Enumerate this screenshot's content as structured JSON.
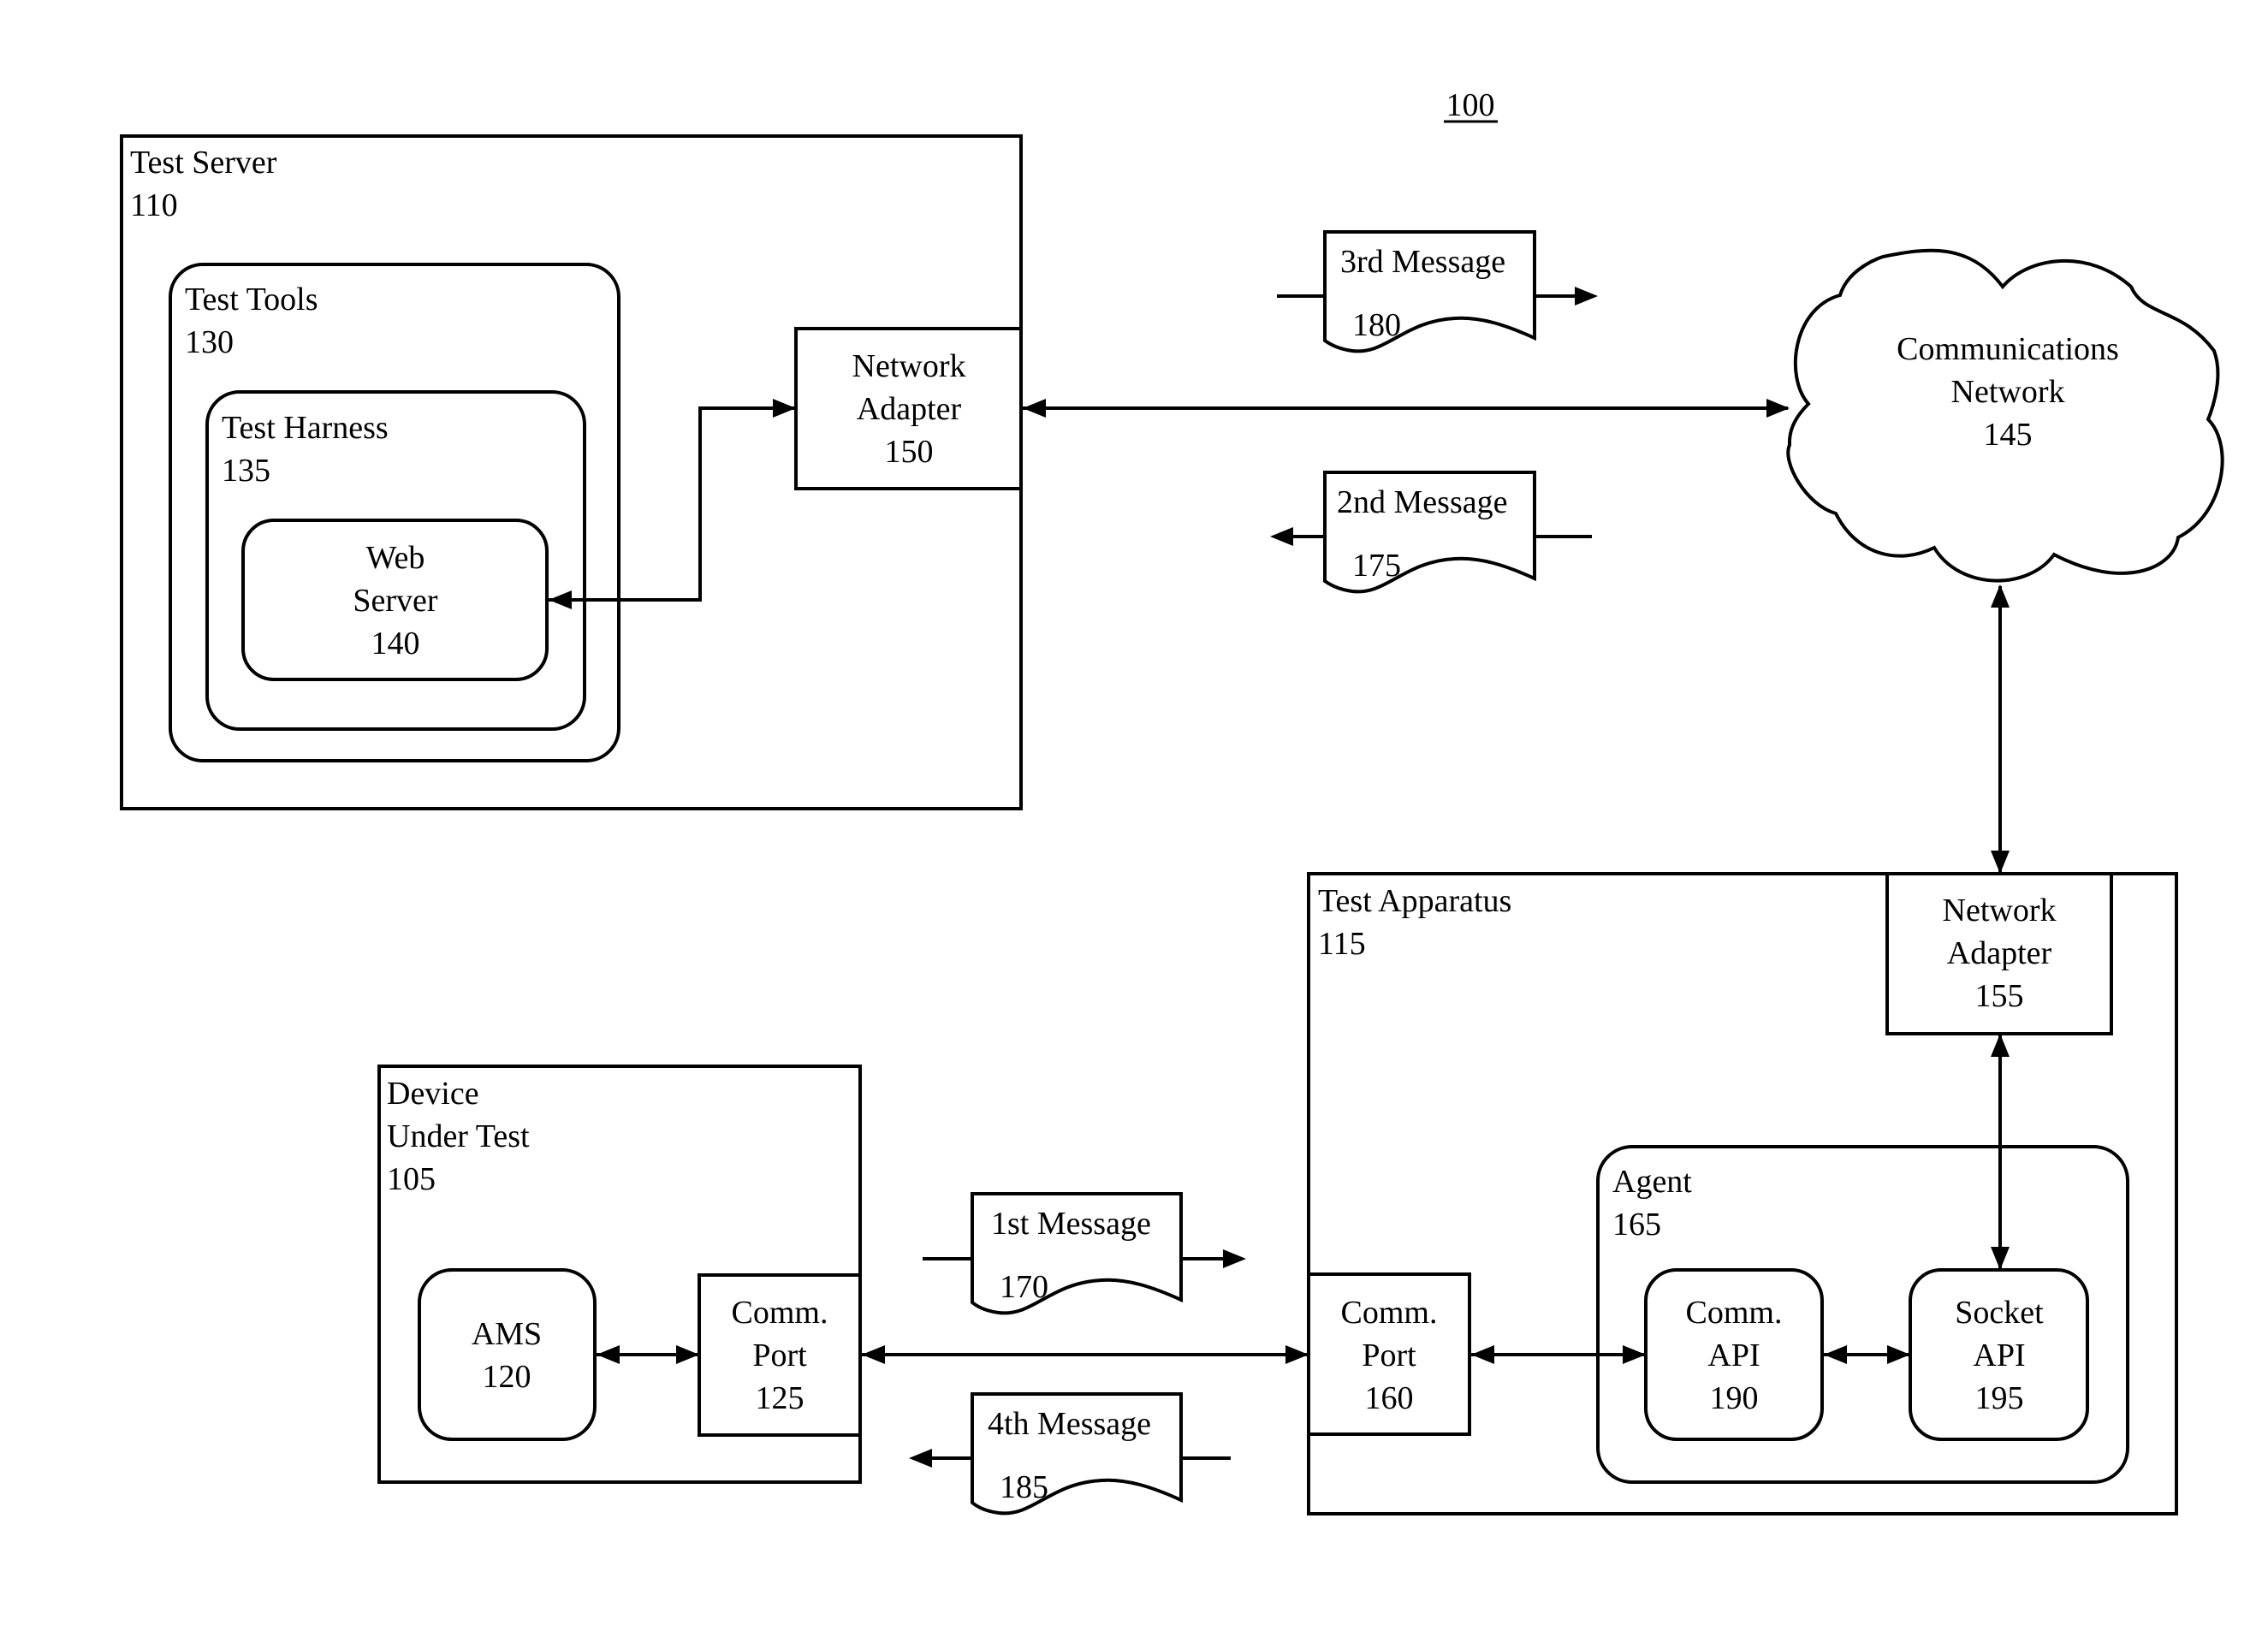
{
  "figure": {
    "number": "100",
    "colors": {
      "stroke": "#000000",
      "background": "#ffffff"
    }
  },
  "nodes": {
    "test_server": {
      "lines": [
        "Test Server",
        "110"
      ]
    },
    "test_tools": {
      "lines": [
        "Test Tools",
        "130"
      ]
    },
    "test_harness": {
      "lines": [
        "Test Harness",
        "135"
      ]
    },
    "web_server": {
      "lines": [
        "Web",
        "Server",
        "140"
      ]
    },
    "network_adapter_150": {
      "lines": [
        "Network",
        "Adapter",
        "150"
      ]
    },
    "communications_network": {
      "lines": [
        "Communications",
        "Network",
        "145"
      ]
    },
    "test_apparatus": {
      "lines": [
        "Test Apparatus",
        "115"
      ]
    },
    "network_adapter_155": {
      "lines": [
        "Network",
        "Adapter",
        "155"
      ]
    },
    "agent": {
      "lines": [
        "Agent",
        "165"
      ]
    },
    "comm_api": {
      "lines": [
        "Comm.",
        "API",
        "190"
      ]
    },
    "socket_api": {
      "lines": [
        "Socket",
        "API",
        "195"
      ]
    },
    "comm_port_160": {
      "lines": [
        "Comm.",
        "Port",
        "160"
      ]
    },
    "device_under_test": {
      "lines": [
        "Device",
        "Under Test",
        "105"
      ]
    },
    "ams": {
      "lines": [
        "AMS",
        "120"
      ]
    },
    "comm_port_125": {
      "lines": [
        "Comm.",
        "Port",
        "125"
      ]
    }
  },
  "messages": {
    "first": {
      "title": "1st Message",
      "ref": "170",
      "direction": "right"
    },
    "second": {
      "title": "2nd Message",
      "ref": "175",
      "direction": "left"
    },
    "third": {
      "title": "3rd Message",
      "ref": "180",
      "direction": "right"
    },
    "fourth": {
      "title": "4th Message",
      "ref": "185",
      "direction": "left"
    }
  },
  "connections": [
    {
      "from": "Web Server 140",
      "to": "Network Adapter 150",
      "bidirectional": true
    },
    {
      "from": "Network Adapter 150",
      "to": "Communications Network 145",
      "bidirectional": true
    },
    {
      "from": "Communications Network 145",
      "to": "Network Adapter 155",
      "bidirectional": true
    },
    {
      "from": "Network Adapter 155",
      "to": "Socket API 195",
      "bidirectional": true
    },
    {
      "from": "Socket API 195",
      "to": "Comm. API 190",
      "bidirectional": true
    },
    {
      "from": "Comm. API 190",
      "to": "Comm. Port 160",
      "bidirectional": true
    },
    {
      "from": "Comm. Port 160",
      "to": "Comm. Port 125",
      "bidirectional": true
    },
    {
      "from": "Comm. Port 125",
      "to": "AMS 120",
      "bidirectional": true
    }
  ]
}
